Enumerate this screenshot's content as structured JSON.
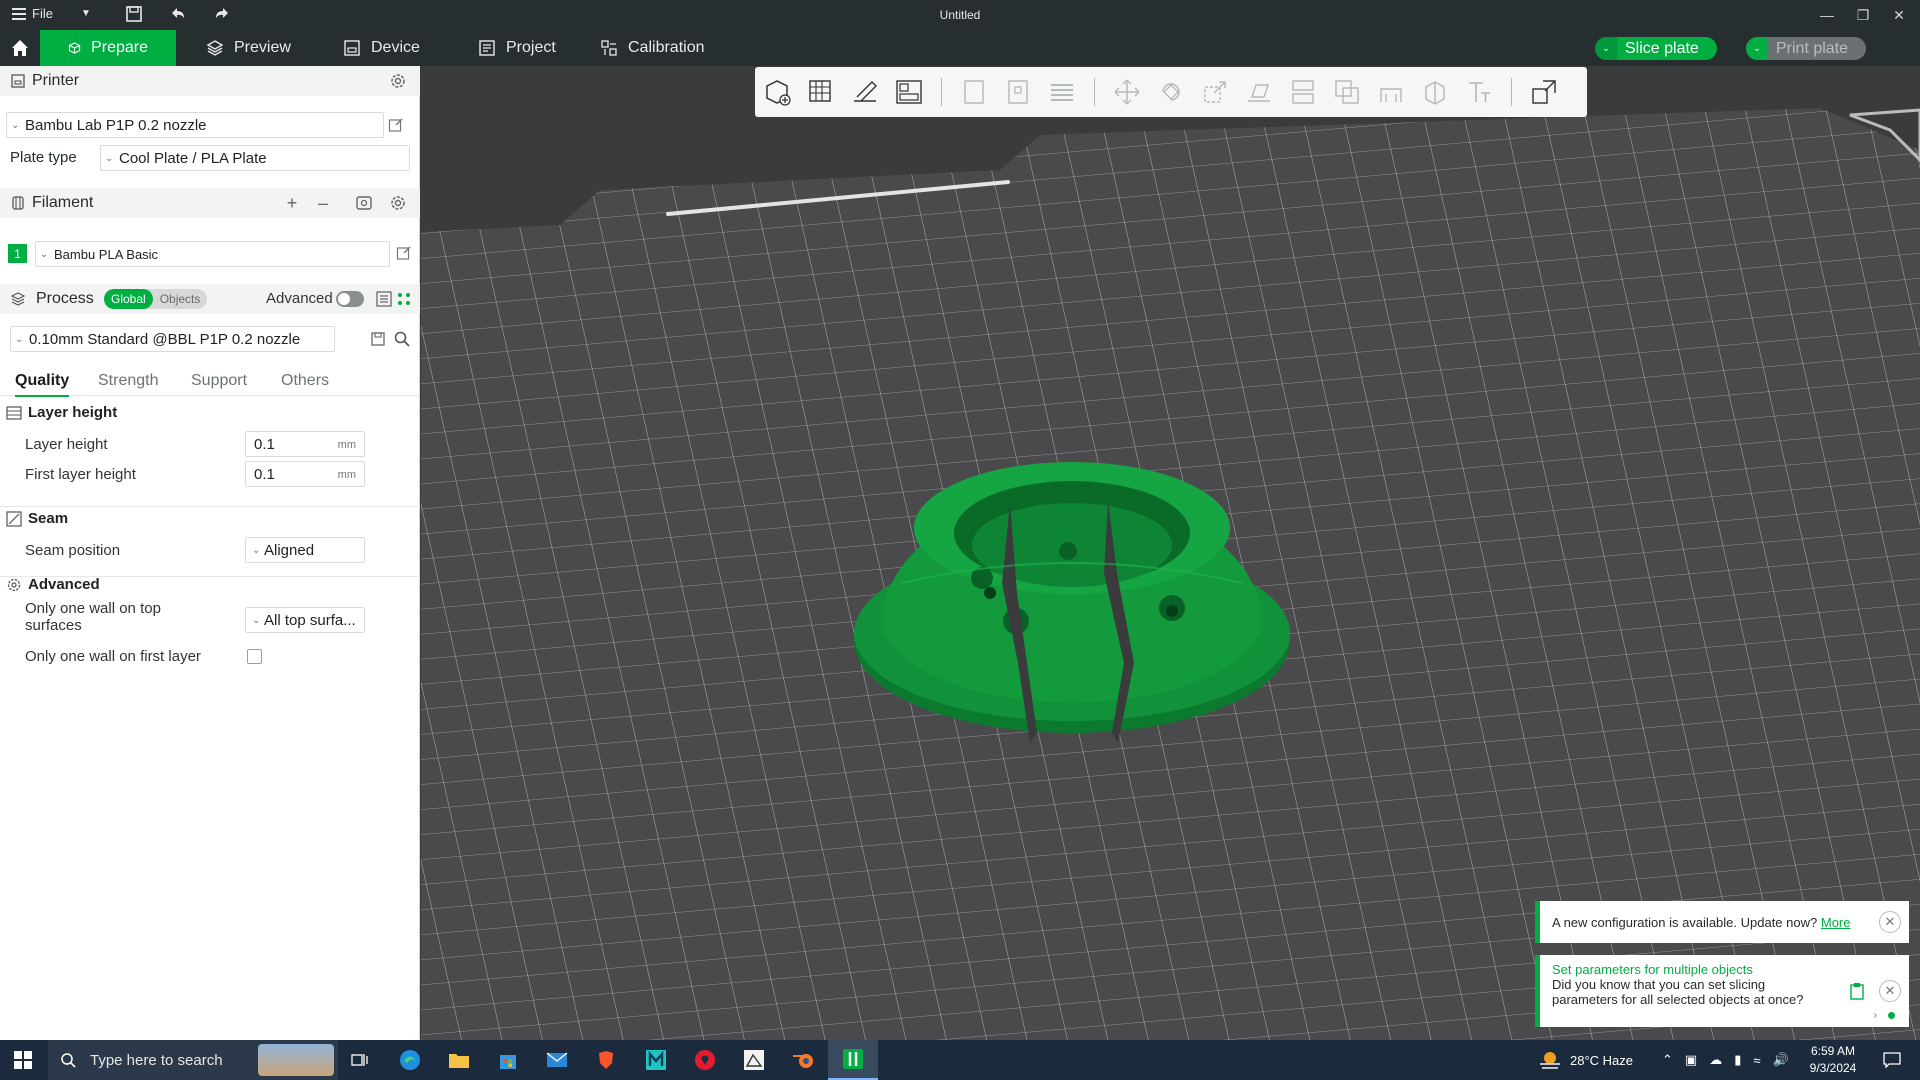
{
  "titlebar": {
    "menu_label": "File",
    "title": "Untitled"
  },
  "tabs": [
    {
      "label": "Prepare",
      "active": true
    },
    {
      "label": "Preview"
    },
    {
      "label": "Device"
    },
    {
      "label": "Project"
    },
    {
      "label": "Calibration"
    }
  ],
  "actions": {
    "slice_label": "Slice plate",
    "print_label": "Print plate"
  },
  "printer": {
    "section_title": "Printer",
    "selected": "Bambu Lab P1P 0.2 nozzle",
    "plate_type_label": "Plate type",
    "plate_type": "Cool Plate / PLA Plate"
  },
  "filament": {
    "section_title": "Filament",
    "slot_number": "1",
    "slot_color": "#00ae42",
    "selected": "Bambu PLA Basic"
  },
  "process": {
    "section_title": "Process",
    "scope_global": "Global",
    "scope_objects": "Objects",
    "advanced_label": "Advanced",
    "advanced_on": false,
    "preset": "0.10mm Standard @BBL P1P 0.2 nozzle",
    "subtabs": [
      "Quality",
      "Strength",
      "Support",
      "Others"
    ],
    "active_subtab": "Quality"
  },
  "quality": {
    "layer_height_group": "Layer height",
    "layer_height_label": "Layer height",
    "layer_height_value": "0.1",
    "first_layer_label": "First layer height",
    "first_layer_value": "0.1",
    "unit": "mm",
    "seam_group": "Seam",
    "seam_position_label": "Seam position",
    "seam_position_value": "Aligned",
    "advanced_group": "Advanced",
    "one_wall_top_label_1": "Only one wall on top",
    "one_wall_top_label_2": "surfaces",
    "one_wall_top_value": "All top surfa...",
    "one_wall_first_label": "Only one wall on first layer",
    "one_wall_first_checked": false
  },
  "notifications": [
    {
      "text": "A new configuration is available. Update now?",
      "link": "More"
    },
    {
      "title": "Set parameters for multiple objects",
      "body_1": "Did you know that you can set slicing",
      "body_2": "parameters for all selected objects at once?"
    }
  ],
  "taskbar": {
    "search_placeholder": "Type here to search",
    "weather": "28°C  Haze",
    "time": "6:59 AM",
    "date": "9/3/2024"
  },
  "colors": {
    "accent": "#00ae42",
    "model": "#0f8a35",
    "bed": "#3b3b3d",
    "toolbar_dark": "#262e30"
  }
}
